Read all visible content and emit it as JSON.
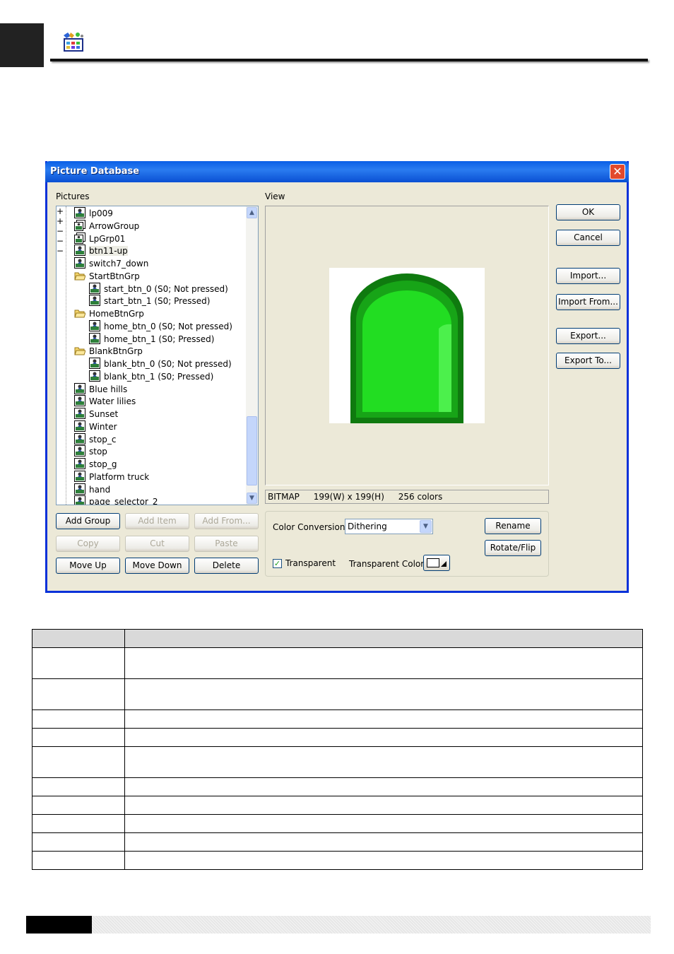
{
  "dialog": {
    "title": "Picture Database",
    "close_glyph": "✕",
    "pictures_label": "Pictures",
    "view_label": "View",
    "tree": [
      {
        "label": "lp009",
        "type": "picture",
        "level": 0
      },
      {
        "label": "ArrowGroup",
        "type": "collapsed-group",
        "level": 0
      },
      {
        "label": "LpGrp01",
        "type": "collapsed-group",
        "level": 0
      },
      {
        "label": "btn11-up",
        "type": "picture",
        "level": 0,
        "selected": true
      },
      {
        "label": "switch7_down",
        "type": "picture",
        "level": 0
      },
      {
        "label": "StartBtnGrp",
        "type": "open-group",
        "level": 0
      },
      {
        "label": "start_btn_0 (S0; Not pressed)",
        "type": "picture",
        "level": 1
      },
      {
        "label": "start_btn_1 (S0; Pressed)",
        "type": "picture",
        "level": 1
      },
      {
        "label": "HomeBtnGrp",
        "type": "open-group",
        "level": 0
      },
      {
        "label": "home_btn_0 (S0; Not pressed)",
        "type": "picture",
        "level": 1
      },
      {
        "label": "home_btn_1 (S0; Pressed)",
        "type": "picture",
        "level": 1
      },
      {
        "label": "BlankBtnGrp",
        "type": "open-group",
        "level": 0
      },
      {
        "label": "blank_btn_0 (S0; Not pressed)",
        "type": "picture",
        "level": 1
      },
      {
        "label": "blank_btn_1 (S0; Pressed)",
        "type": "picture",
        "level": 1
      },
      {
        "label": "Blue hills",
        "type": "picture",
        "level": 0
      },
      {
        "label": "Water lilies",
        "type": "picture",
        "level": 0
      },
      {
        "label": "Sunset",
        "type": "picture",
        "level": 0
      },
      {
        "label": "Winter",
        "type": "picture",
        "level": 0
      },
      {
        "label": "stop_c",
        "type": "picture",
        "level": 0
      },
      {
        "label": "stop",
        "type": "picture",
        "level": 0
      },
      {
        "label": "stop_g",
        "type": "picture",
        "level": 0
      },
      {
        "label": "Platform truck",
        "type": "picture",
        "level": 0
      },
      {
        "label": "hand",
        "type": "picture",
        "level": 0
      },
      {
        "label": "page_selector_2",
        "type": "picture",
        "level": 0
      }
    ],
    "buttons": {
      "add_group": "Add Group",
      "add_item": "Add Item",
      "add_from": "Add From...",
      "copy": "Copy",
      "cut": "Cut",
      "paste": "Paste",
      "move_up": "Move Up",
      "move_down": "Move Down",
      "delete": "Delete",
      "ok": "OK",
      "cancel": "Cancel",
      "import": "Import...",
      "import_from": "Import From...",
      "export": "Export...",
      "export_to": "Export To...",
      "rename": "Rename",
      "rotate_flip": "Rotate/Flip"
    },
    "info": {
      "format": "BITMAP",
      "size": "199(W) x 199(H)",
      "colors": "256 colors"
    },
    "options": {
      "color_conversion_label": "Color Conversion:",
      "color_conversion_value": "Dithering",
      "transparent_label": "Transparent",
      "transparent_checked": true,
      "transparent_color_label": "Transparent Color:"
    },
    "colors": {
      "title_bar": "#0a5fe6",
      "preview_dark": "#0f7a0f",
      "preview_light": "#22dd22"
    }
  },
  "table": {
    "row_count": 10
  }
}
